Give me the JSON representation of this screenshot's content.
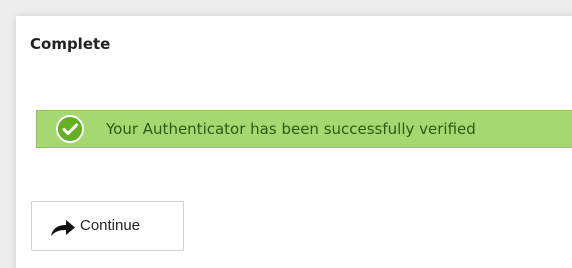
{
  "panel": {
    "title": "Complete"
  },
  "alert": {
    "message": "Your Authenticator has been successfully verified",
    "icon": "check-circle-icon",
    "background_color": "#a6d871",
    "icon_color": "#5aa61f"
  },
  "actions": {
    "continue_label": "Continue",
    "continue_icon": "share-arrow-icon"
  }
}
